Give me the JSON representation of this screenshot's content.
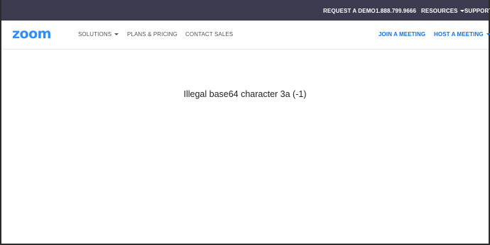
{
  "topbar": {
    "request_demo": "REQUEST A DEMO",
    "phone": "1.888.799.9666",
    "resources": "RESOURCES",
    "support": "SUPPORT"
  },
  "navbar": {
    "logo": "zoom",
    "solutions": "SOLUTIONS",
    "plans_pricing": "PLANS & PRICING",
    "contact_sales": "CONTACT SALES",
    "join_meeting": "JOIN A MEETING",
    "host_meeting": "HOST A MEETING"
  },
  "main": {
    "error_message": "Illegal base64 character 3a (-1)"
  },
  "colors": {
    "topbar_bg": "#3d3b4f",
    "brand_blue": "#2d8cff",
    "link_blue": "#0e71eb"
  }
}
